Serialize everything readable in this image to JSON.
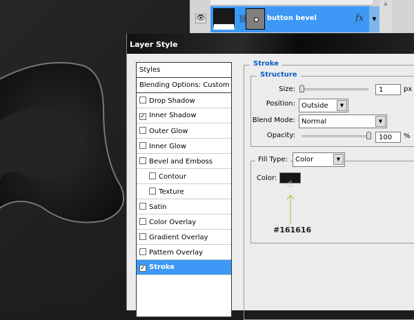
{
  "layers_panel": {
    "layer_name": "button bevel",
    "fx_label": "fx"
  },
  "dialog": {
    "title": "Layer Style",
    "styles_list": [
      {
        "label": "Styles",
        "type": "header"
      },
      {
        "label": "Blending Options: Custom",
        "type": "header"
      },
      {
        "label": "Drop Shadow",
        "checked": false
      },
      {
        "label": "Inner Shadow",
        "checked": true
      },
      {
        "label": "Outer Glow",
        "checked": false
      },
      {
        "label": "Inner Glow",
        "checked": false
      },
      {
        "label": "Bevel and Emboss",
        "checked": false
      },
      {
        "label": "Contour",
        "checked": false,
        "indent": true
      },
      {
        "label": "Texture",
        "checked": false,
        "indent": true
      },
      {
        "label": "Satin",
        "checked": false
      },
      {
        "label": "Color Overlay",
        "checked": false
      },
      {
        "label": "Gradient Overlay",
        "checked": false
      },
      {
        "label": "Pattern Overlay",
        "checked": false
      },
      {
        "label": "Stroke",
        "checked": true,
        "selected": true
      }
    ],
    "stroke": {
      "title": "Stroke",
      "structure_title": "Structure",
      "size_label": "Size:",
      "size_value": "1",
      "size_unit": "px",
      "position_label": "Position:",
      "position_value": "Outside",
      "blend_label": "Blend Mode:",
      "blend_value": "Normal",
      "opacity_label": "Opacity:",
      "opacity_value": "100",
      "opacity_unit": "%",
      "fill_type_label": "Fill Type:",
      "fill_type_value": "Color",
      "color_label": "Color:",
      "color_value": "#161616",
      "annotation": "#161616"
    }
  },
  "colors": {
    "selection": "#3d99f5",
    "accent_text": "#0a5fc0",
    "arrow": "#a0c828"
  }
}
